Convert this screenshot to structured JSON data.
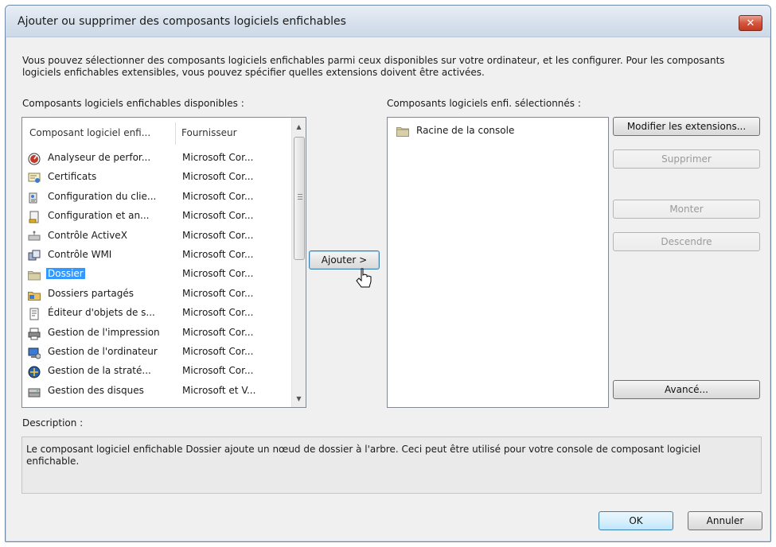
{
  "window": {
    "title": "Ajouter ou supprimer des composants logiciels enfichables",
    "close_glyph": "✕"
  },
  "intro_text": "Vous pouvez sélectionner des composants logiciels enfichables parmi ceux disponibles sur votre ordinateur, et les configurer. Pour les composants logiciels enfichables extensibles, vous pouvez spécifier quelles extensions doivent être activées.",
  "available": {
    "label": "Composants logiciels enfichables disponibles :",
    "columns": [
      "Composant logiciel enfi...",
      "Fournisseur"
    ],
    "items": [
      {
        "name": "Analyseur de perfor...",
        "provider": "Microsoft Cor...",
        "icon": "performance-icon",
        "selected": false
      },
      {
        "name": "Certificats",
        "provider": "Microsoft Cor...",
        "icon": "certificate-icon",
        "selected": false
      },
      {
        "name": "Configuration du clie...",
        "provider": "Microsoft Cor...",
        "icon": "client-config-icon",
        "selected": false
      },
      {
        "name": "Configuration et an...",
        "provider": "Microsoft Cor...",
        "icon": "security-config-icon",
        "selected": false
      },
      {
        "name": "Contrôle ActiveX",
        "provider": "Microsoft Cor...",
        "icon": "activex-icon",
        "selected": false
      },
      {
        "name": "Contrôle WMI",
        "provider": "Microsoft Cor...",
        "icon": "wmi-icon",
        "selected": false
      },
      {
        "name": "Dossier",
        "provider": "Microsoft Cor...",
        "icon": "folder-icon",
        "selected": true
      },
      {
        "name": "Dossiers partagés",
        "provider": "Microsoft Cor...",
        "icon": "shared-folders-icon",
        "selected": false
      },
      {
        "name": "Éditeur d'objets de s...",
        "provider": "Microsoft Cor...",
        "icon": "policy-editor-icon",
        "selected": false
      },
      {
        "name": "Gestion de l'impression",
        "provider": "Microsoft Cor...",
        "icon": "print-management-icon",
        "selected": false
      },
      {
        "name": "Gestion de l'ordinateur",
        "provider": "Microsoft Cor...",
        "icon": "computer-management-icon",
        "selected": false
      },
      {
        "name": "Gestion de la straté...",
        "provider": "Microsoft Cor...",
        "icon": "group-policy-icon",
        "selected": false
      },
      {
        "name": "Gestion des disques",
        "provider": "Microsoft et V...",
        "icon": "disk-management-icon",
        "selected": false
      }
    ]
  },
  "add_button": "Ajouter >",
  "selected": {
    "label": "Composants logiciels enfi. sélectionnés :",
    "items": [
      {
        "name": "Racine de la console",
        "icon": "folder-icon"
      }
    ]
  },
  "side_buttons": {
    "edit_extensions": "Modifier les extensions...",
    "remove": "Supprimer",
    "move_up": "Monter",
    "move_down": "Descendre",
    "advanced": "Avancé..."
  },
  "description": {
    "label": "Description :",
    "text": "Le composant logiciel enfichable Dossier ajoute un nœud de dossier à l'arbre. Ceci peut être utilisé pour votre console de composant logiciel enfichable."
  },
  "footer": {
    "ok": "OK",
    "cancel": "Annuler"
  }
}
